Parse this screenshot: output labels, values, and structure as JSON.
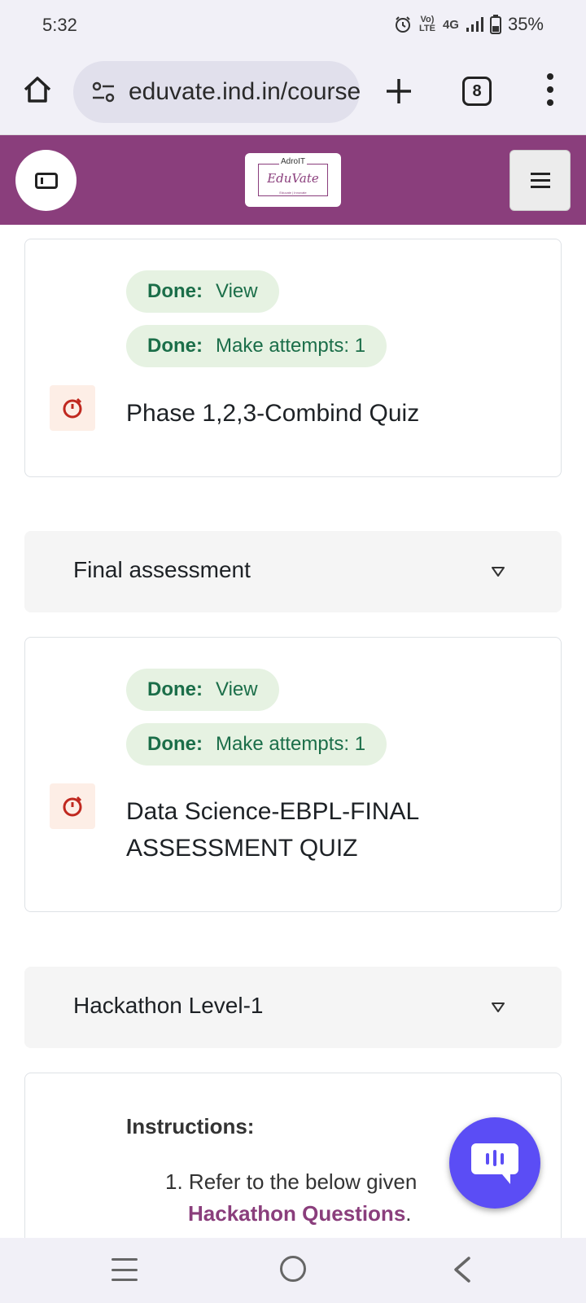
{
  "status_bar": {
    "time": "5:32",
    "network": "4G",
    "volte": "Vo) LTE",
    "battery": "35%"
  },
  "browser": {
    "url": "eduvate.ind.in/course",
    "tab_count": "8"
  },
  "site_header": {
    "logo_top": "AdroIT",
    "logo_main": "EduVate",
    "logo_sub": "Educate | Innovate"
  },
  "activities": [
    {
      "completions": [
        {
          "label": "Done:",
          "value": "View"
        },
        {
          "label": "Done:",
          "value": "Make attempts: 1"
        }
      ],
      "name": "Phase 1,2,3-Combind Quiz"
    },
    {
      "completions": [
        {
          "label": "Done:",
          "value": "View"
        },
        {
          "label": "Done:",
          "value": "Make attempts: 1"
        }
      ],
      "name": "Data Science-EBPL-FINAL ASSESSMENT QUIZ"
    }
  ],
  "sections": [
    {
      "title": "Final assessment"
    },
    {
      "title": "Hackathon Level-1"
    }
  ],
  "instructions": {
    "title": "Instructions:",
    "item_number": "1.",
    "item_text": "Refer to the below given",
    "item_link": "Hackathon Questions",
    "item_suffix": "."
  },
  "colors": {
    "brand": "#8a3e7c",
    "done_bg": "#e6f2e2",
    "done_text": "#1b6e49",
    "quiz_icon": "#c0281f",
    "chat_fab": "#5b4df5"
  }
}
